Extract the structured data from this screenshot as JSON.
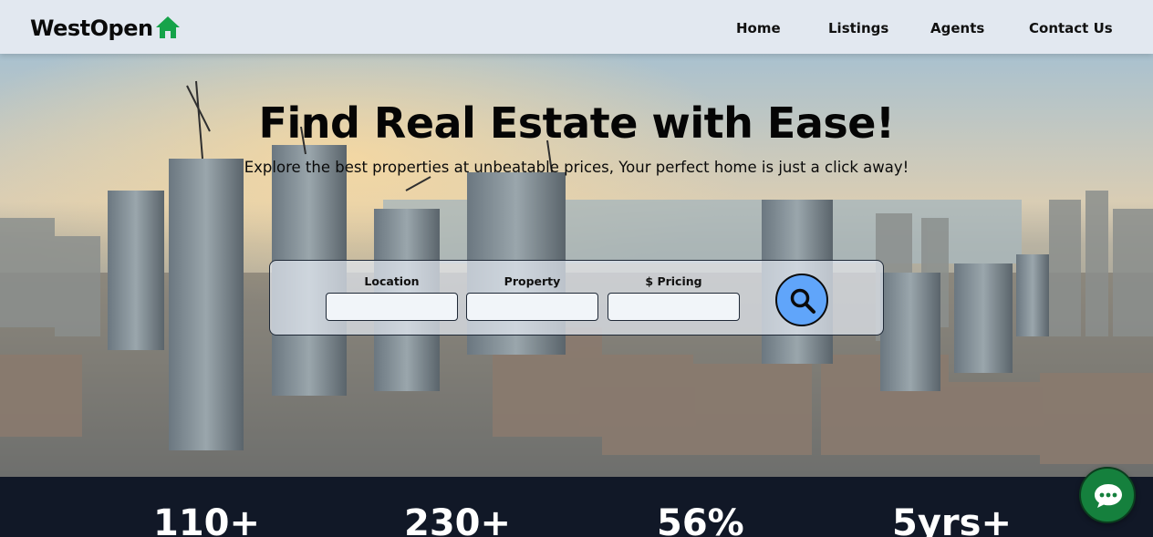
{
  "navbar": {
    "brand": "WestOpen",
    "brand_icon": "house-icon",
    "links": [
      {
        "label": "Home"
      },
      {
        "label": "Listings"
      },
      {
        "label": "Agents"
      },
      {
        "label": "Contact Us"
      }
    ]
  },
  "hero": {
    "title": "Find Real Estate with Ease!",
    "subtitle": "Explore the best properties at unbeatable prices, Your perfect home is just a click away!"
  },
  "search": {
    "fields": [
      {
        "label": "Location",
        "value": ""
      },
      {
        "label": "Property",
        "value": ""
      },
      {
        "label": "$ Pricing",
        "value": ""
      }
    ],
    "button_icon": "search-icon"
  },
  "stats": [
    {
      "value": "110+"
    },
    {
      "value": "230+"
    },
    {
      "value": "56%"
    },
    {
      "value": "5yrs+"
    }
  ],
  "chat": {
    "icon": "chat-bubble-icon"
  },
  "colors": {
    "navbar_bg": "#e2e8f0",
    "brand_icon": "#16a34a",
    "search_button": "#60a5fa",
    "stats_bg": "#111827",
    "chat_button": "#15803d"
  }
}
